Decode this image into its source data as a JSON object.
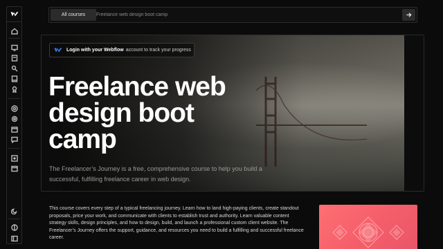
{
  "sidebar": {
    "logo": "webflow-logo",
    "items": [
      {
        "icon": "home-icon"
      },
      {
        "icon": "courses-icon"
      },
      {
        "icon": "lessons-icon"
      },
      {
        "icon": "tools-icon"
      },
      {
        "icon": "book-icon"
      },
      {
        "icon": "award-icon"
      },
      {
        "icon": "at-icon"
      },
      {
        "icon": "settings-icon"
      },
      {
        "icon": "calendar-icon"
      },
      {
        "icon": "chat-icon"
      },
      {
        "icon": "add-icon"
      },
      {
        "icon": "window-icon"
      },
      {
        "icon": "theme-moon-icon"
      },
      {
        "icon": "contrast-icon"
      },
      {
        "icon": "collapse-sidebar-icon"
      }
    ]
  },
  "search": {
    "scope_label": "All courses",
    "placeholder": "Freelance web design boot camp"
  },
  "hero": {
    "login_bold": "Login with your Webflow",
    "login_rest": "account to track your progress",
    "title": "Freelance web design boot camp",
    "subtitle": "The Freelancer’s Journey is a free, comprehensive course to help you build a successful, fulfilling freelance career in web design."
  },
  "body": {
    "description": "This course covers every step of a typical freelancing journey. Learn how to land high-paying clients, create standout proposals, price your work, and communicate with clients to establish trust and authority. Learn valuable content strategy skills, design principles, and how to design, build, and launch a professional custom client website. The Freelancer’s Journey offers the support, guidance, and resources you need to build a fulfilling and successful freelance career."
  },
  "colors": {
    "background": "#0b0b0b",
    "thumbnail_coral": "#f55f6b"
  }
}
